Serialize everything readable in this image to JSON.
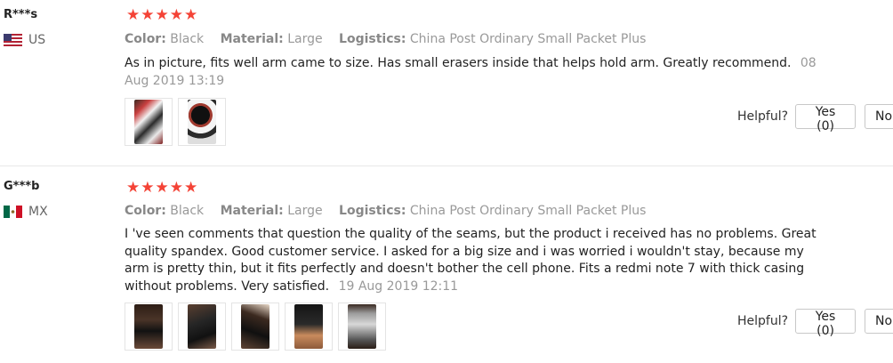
{
  "reviews": [
    {
      "user": "R***s",
      "country": "US",
      "flag": "us-flag-icon",
      "rating": 5,
      "attributes": [
        {
          "key": "Color:",
          "value": "Black"
        },
        {
          "key": "Material:",
          "value": "Large"
        },
        {
          "key": "Logistics:",
          "value": "China Post Ordinary Small Packet Plus"
        }
      ],
      "text": "As in picture, fits well arm came to size. Has small erasers inside that helps hold arm. Greatly recommend.",
      "date": "08 Aug 2019 13:19",
      "helpful_label": "Helpful?",
      "yes_label": "Yes (0)",
      "no_label": "No"
    },
    {
      "user": "G***b",
      "country": "MX",
      "flag": "mx-flag-icon",
      "rating": 5,
      "attributes": [
        {
          "key": "Color:",
          "value": "Black"
        },
        {
          "key": "Material:",
          "value": "Large"
        },
        {
          "key": "Logistics:",
          "value": "China Post Ordinary Small Packet Plus"
        }
      ],
      "text": "I 've seen comments that question the quality of the seams, but the product i received has no problems. Great quality spandex. Good customer service. I asked for a big size and i was worried i wouldn't stay, because my arm is pretty thin, but it fits perfectly and doesn't bother the cell phone. Fits a redmi note 7 with thick casing without problems. Very satisfied.",
      "date": "19 Aug 2019 12:11",
      "helpful_label": "Helpful?",
      "yes_label": "Yes (0)",
      "no_label": "No"
    }
  ],
  "colors": {
    "star": "#f44336",
    "divider": "#e8e8e8",
    "muted": "#999999"
  }
}
